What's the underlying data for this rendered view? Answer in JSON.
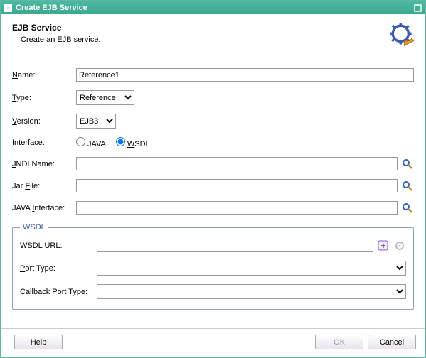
{
  "window": {
    "title": "Create EJB Service"
  },
  "header": {
    "title": "EJB Service",
    "subtitle": "Create an EJB service."
  },
  "form": {
    "name_label_pre": "",
    "name_mn": "N",
    "name_label_post": "ame:",
    "name_value": "Reference1",
    "type_mn": "T",
    "type_label_post": "ype:",
    "type_value": "Reference",
    "version_mn": "V",
    "version_label_post": "ersion:",
    "version_value": "EJB3",
    "interface_label": "Interface:",
    "java_radio": "JAVA",
    "wsdl_radio_mn": "W",
    "wsdl_radio_post": "SDL",
    "jndi_mn": "J",
    "jndi_post": "NDI Name:",
    "jar_pre": "Jar ",
    "jar_mn": "F",
    "jar_post": "ile:",
    "javaif_pre": "JAVA ",
    "javaif_mn": "I",
    "javaif_post": "nterface:"
  },
  "wsdl": {
    "legend": "WSDL",
    "url_pre": "WSDL ",
    "url_mn": "U",
    "url_post": "RL:",
    "port_mn": "P",
    "port_post": "ort Type:",
    "callback_pre": "Call",
    "callback_mn": "b",
    "callback_post": "ack Port Type:"
  },
  "buttons": {
    "help": "Help",
    "ok": "OK",
    "cancel": "Cancel"
  }
}
